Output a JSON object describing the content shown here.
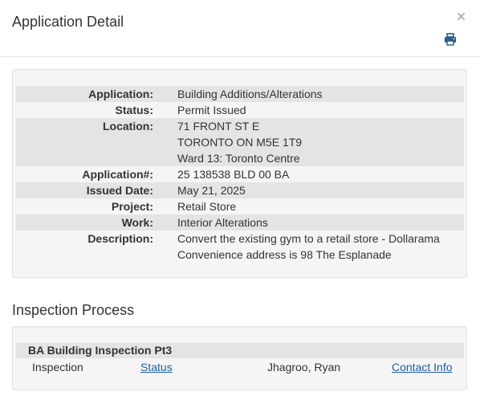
{
  "header": {
    "title": "Application Detail",
    "close_glyph": "×",
    "print_icon": "printer-icon"
  },
  "detail": {
    "application": {
      "label": "Application:",
      "value": "Building Additions/Alterations"
    },
    "status": {
      "label": "Status:",
      "value": "Permit Issued"
    },
    "location": {
      "label": "Location:",
      "lines": [
        "71 FRONT ST E",
        "TORONTO ON M5E 1T9",
        "Ward 13: Toronto Centre"
      ]
    },
    "application_no": {
      "label": "Application#:",
      "value": "25 138538 BLD 00 BA"
    },
    "issued_date": {
      "label": "Issued Date:",
      "value": "May 21, 2025"
    },
    "project": {
      "label": "Project:",
      "value": "Retail Store"
    },
    "work": {
      "label": "Work:",
      "value": "Interior Alterations"
    },
    "description": {
      "label": "Description:",
      "lines": [
        "Convert the existing gym to a retail store - Dollarama",
        "Convenience address is 98 The Esplanade"
      ]
    }
  },
  "inspection": {
    "section_title": "Inspection Process",
    "group_title": "BA Building Inspection Pt3",
    "row": {
      "type": "Inspection",
      "status_link": "Status",
      "inspector": "Jhagroo, Ryan",
      "contact_link": "Contact Info"
    }
  },
  "colors": {
    "link": "#1f5fa6",
    "row_shade": "#e4e4e4",
    "panel_bg": "#f5f5f5",
    "print_icon": "#2a5d8a"
  }
}
